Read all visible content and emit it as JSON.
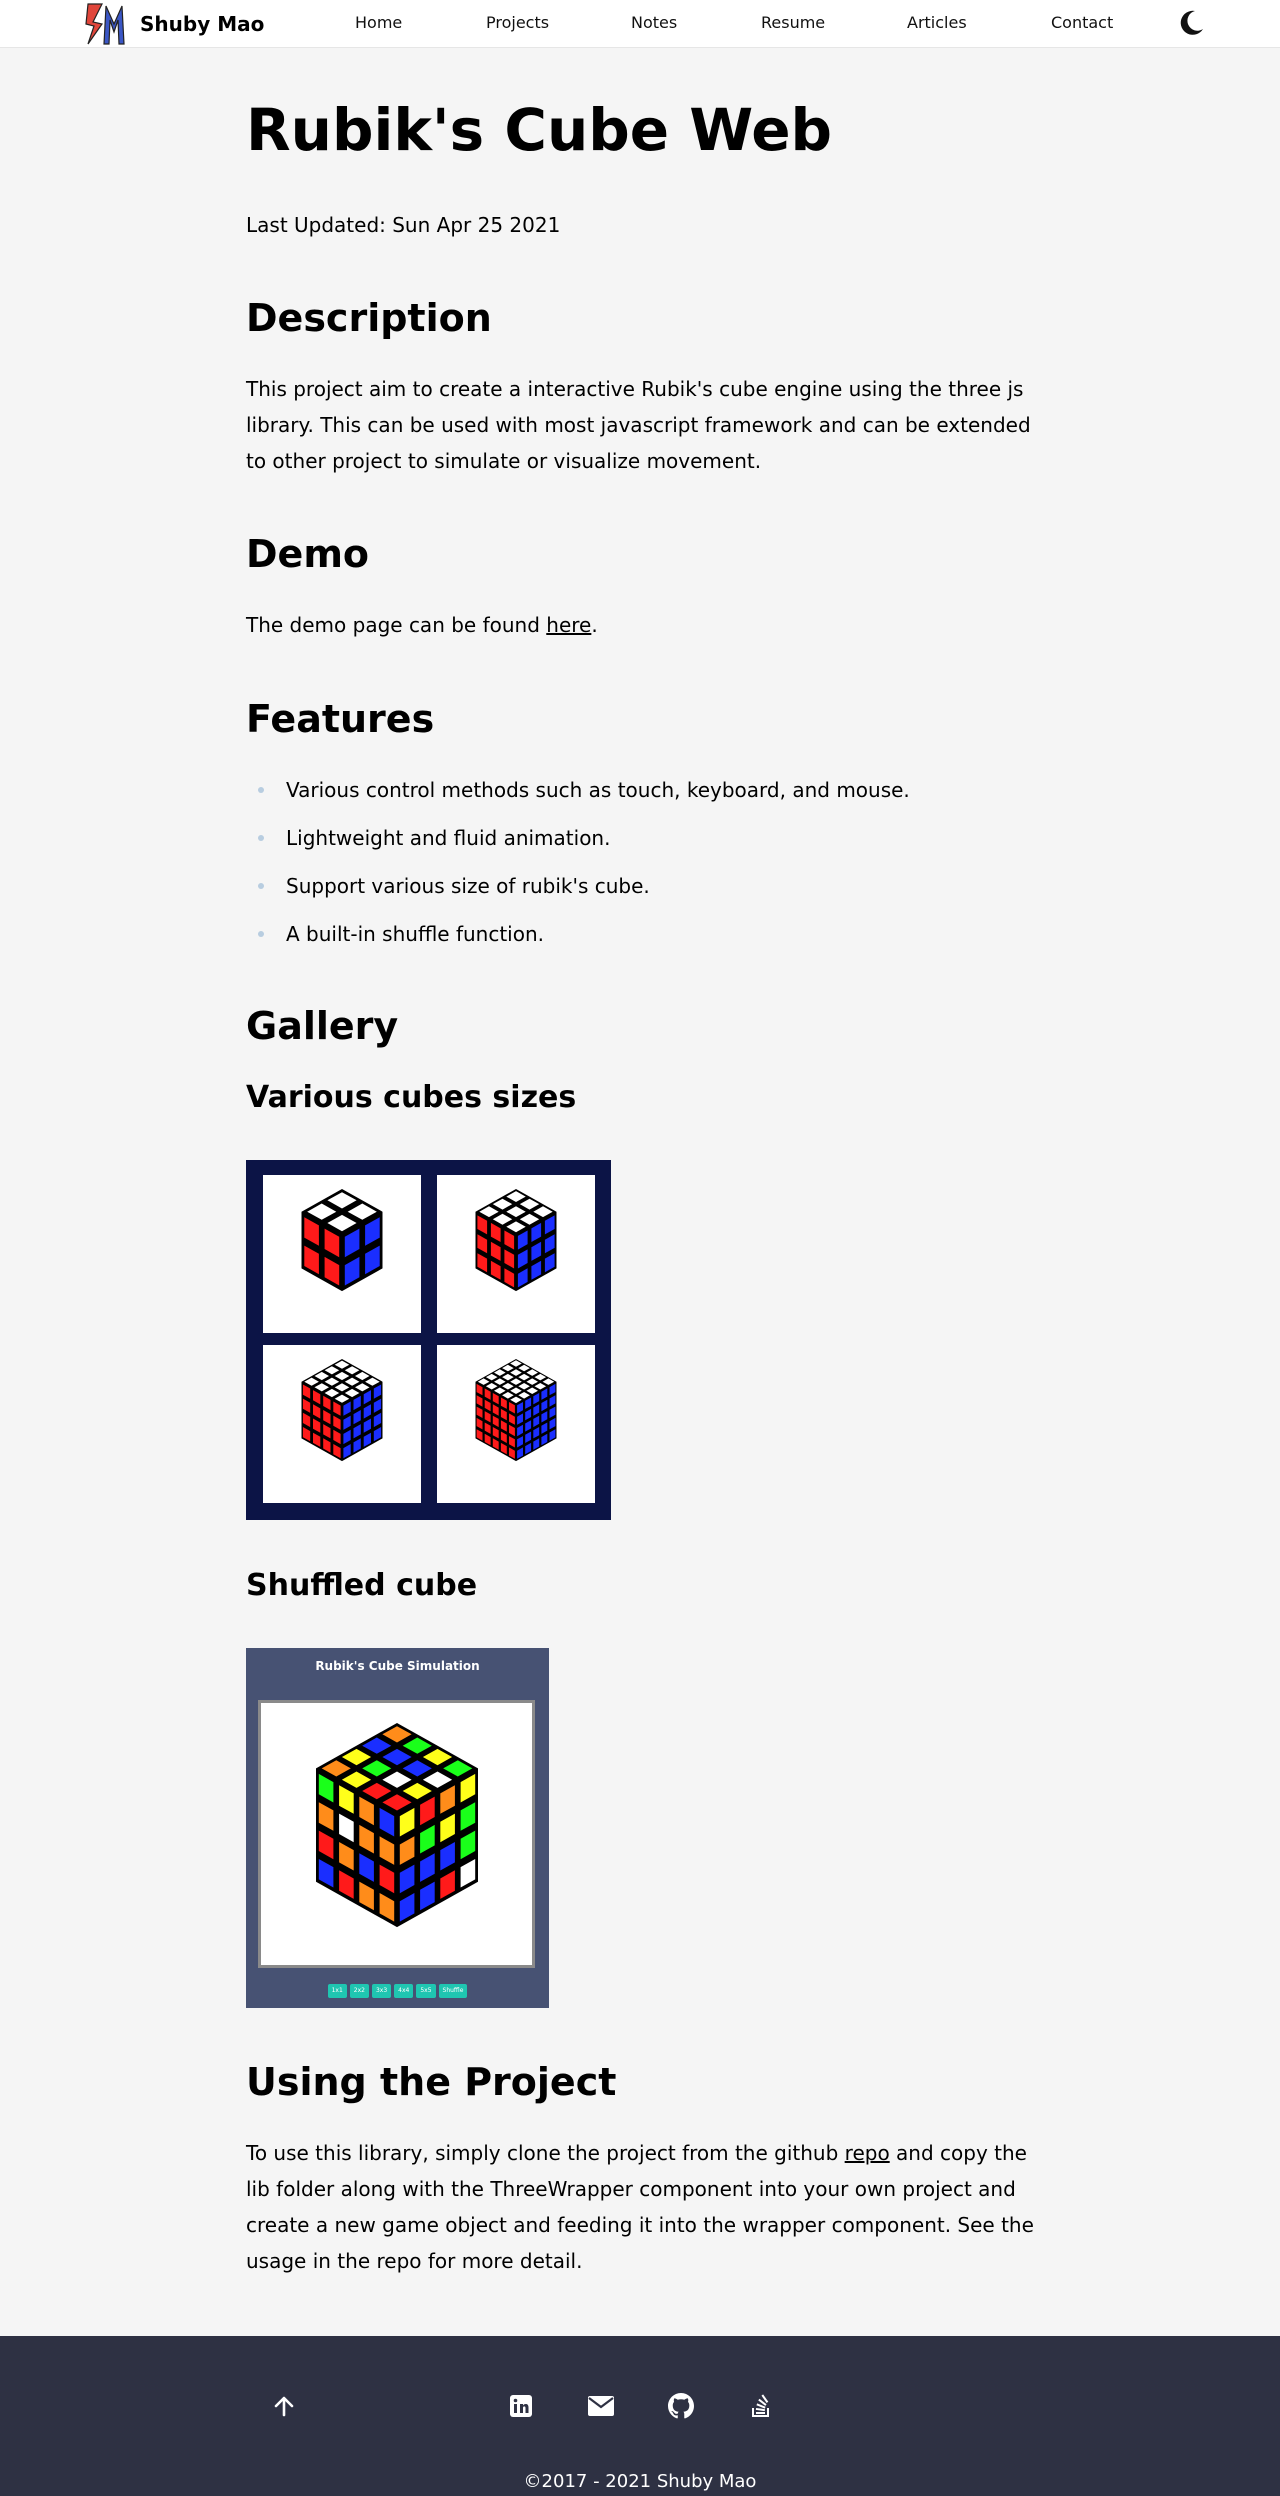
{
  "nav": {
    "brand": "Shuby Mao",
    "links": [
      "Home",
      "Projects",
      "Notes",
      "Resume",
      "Articles",
      "Contact"
    ],
    "theme_icon": "moon-icon"
  },
  "page": {
    "title": "Rubik's Cube Web",
    "last_updated": "Last Updated: Sun Apr 25 2021"
  },
  "description": {
    "heading": "Description",
    "text": "This project aim to create a interactive Rubik's cube engine using the three js library. This can be used with most javascript framework and can be extended to other project to simulate or visualize movement."
  },
  "demo": {
    "heading": "Demo",
    "text_before": "The demo page can be found ",
    "link": "here",
    "text_after": "."
  },
  "features": {
    "heading": "Features",
    "items": [
      "Various control methods such as touch, keyboard, and mouse.",
      "Lightweight and fluid animation.",
      "Support various size of rubik's cube.",
      "A built-in shuffle function."
    ]
  },
  "gallery": {
    "heading": "Gallery",
    "sub1": "Various cubes sizes",
    "sub2": "Shuffled cube",
    "sim_title": "Rubik's Cube Simulation",
    "sim_buttons": [
      "1x1",
      "2x2",
      "3x3",
      "4x4",
      "5x5",
      "Shuffle"
    ]
  },
  "usage": {
    "heading": "Using the Project",
    "text_before": "To use this library, simply clone the project from the github ",
    "link": "repo",
    "text_after": " and copy the lib folder along with the ThreeWrapper component into your own project and create a new game object and feeding it into the wrapper component. See the usage in the repo for more detail."
  },
  "footer": {
    "icons": [
      "arrow-up-icon",
      "linkedin-icon",
      "email-icon",
      "github-icon",
      "stackoverflow-icon"
    ],
    "copyright": "©2017 - 2021 Shuby Mao"
  },
  "colors": {
    "background": "#f5f5f5",
    "footer": "#2e3143",
    "gallery_frame": "#0c1446",
    "sim_panel": "#475273",
    "sim_button": "#1fc6b1"
  }
}
